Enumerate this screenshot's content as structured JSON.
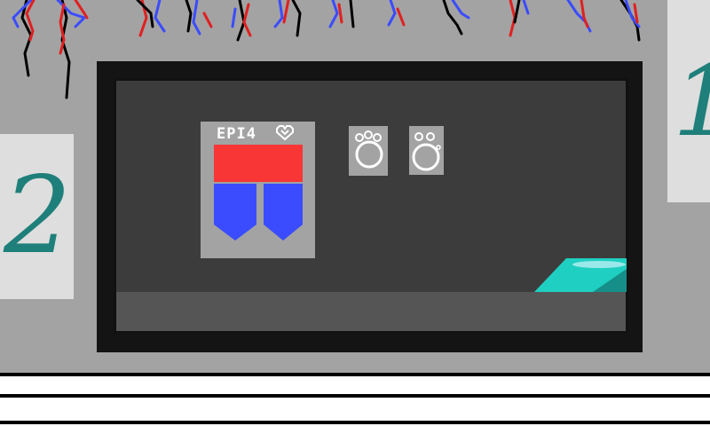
{
  "posters": {
    "right_number": "1",
    "left_number": "2"
  },
  "card": {
    "title": "EPI4",
    "heart_icon": "heart-outline-icon"
  },
  "colors": {
    "wall": "#a3a3a3",
    "screen_bg": "#3c3c3c",
    "frame": "#141414",
    "floor": "#555555",
    "red_bar": "#f83636",
    "blue_banner": "#3b4cff",
    "pad": "#1fcfc1",
    "poster_ink": "#1f7f7a"
  },
  "orbs": [
    {
      "name": "orb-slot-1",
      "icon": "ring-orb-icon"
    },
    {
      "name": "orb-slot-2",
      "icon": "ring-orb-icon"
    }
  ],
  "wires_icon": "hanging-wires-icon",
  "pad_icon": "teleport-pad-icon"
}
